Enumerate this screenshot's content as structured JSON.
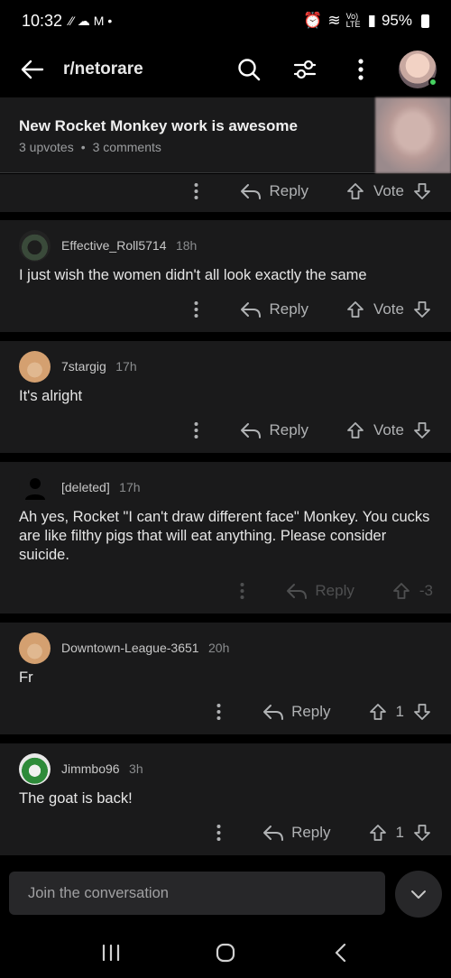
{
  "status_bar": {
    "time": "10:32",
    "left_icons": [
      "missed-call-icon",
      "cloud-icon",
      "gmail-icon",
      "dot-icon"
    ],
    "signal_text": "Vo) LTE",
    "battery_percent": "95%"
  },
  "header": {
    "subreddit": "r/netorare"
  },
  "post": {
    "title": "New Rocket Monkey work is awesome",
    "upvotes": "3 upvotes",
    "separator": "•",
    "comments": "3 comments"
  },
  "top_actions": {
    "reply": "Reply",
    "vote": "Vote"
  },
  "comments": [
    {
      "username": "Effective_Roll5714",
      "time": "18h",
      "body": "I just wish the women didn't all look exactly the same",
      "reply": "Reply",
      "vote": "Vote"
    },
    {
      "username": "7stargig",
      "time": "17h",
      "body": "It's alright",
      "reply": "Reply",
      "vote": "Vote"
    },
    {
      "username": "[deleted]",
      "time": "17h",
      "body": "Ah yes, Rocket \"I can't draw different face\" Monkey. You cucks are like filthy pigs that will eat anything. Please consider suicide.",
      "reply": "Reply",
      "vote": "-3"
    },
    {
      "username": "Downtown-League-3651",
      "time": "20h",
      "body": "Fr",
      "reply": "Reply",
      "vote": "1"
    },
    {
      "username": "Jimmbo96",
      "time": "3h",
      "body": "The goat is back!",
      "reply": "Reply",
      "vote": "1"
    }
  ],
  "composer": {
    "placeholder": "Join the conversation"
  },
  "colors": {
    "background": "#000000",
    "card": "#1a1a1b",
    "text": "#d7dadc",
    "muted": "#8a8c8e",
    "online": "#46d160"
  }
}
